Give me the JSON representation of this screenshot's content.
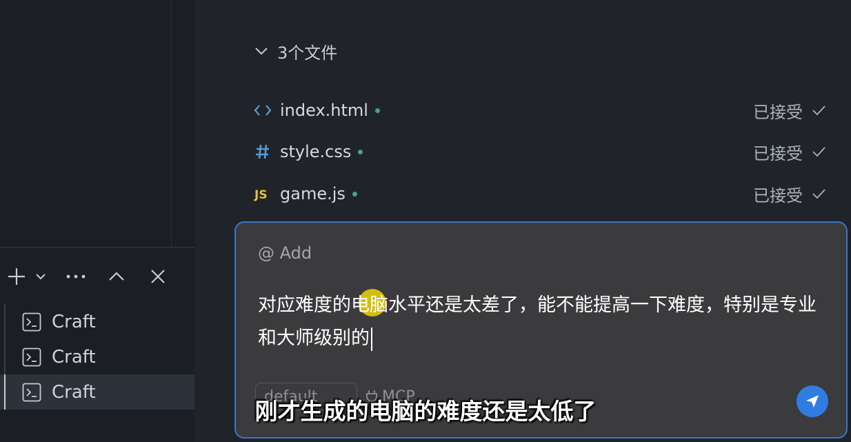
{
  "files": {
    "header": "3个文件",
    "items": [
      {
        "icon": "html-code-icon",
        "name": "index.html",
        "status": "已接受"
      },
      {
        "icon": "hash-icon",
        "name": "style.css",
        "status": "已接受"
      },
      {
        "icon": "js-icon",
        "name": "game.js",
        "status": "已接受"
      }
    ]
  },
  "terminal": {
    "toolbar": [
      "add-icon",
      "chevron-down-icon",
      "more-icon",
      "chevron-up-icon",
      "close-icon"
    ],
    "items": [
      {
        "label": "Craft",
        "active": false
      },
      {
        "label": "Craft",
        "active": false
      },
      {
        "label": "Craft",
        "active": true
      }
    ]
  },
  "chat": {
    "mention_label": "@ Add",
    "input_text": "对应难度的电脑水平还是太差了，能不能提高一下难度，特别是专业和大师级别的",
    "mode_label": "default",
    "mcp_label": "MCP"
  },
  "subtitle": "刚才生成的电脑的难度还是太低了",
  "colors": {
    "accent": "#3b76c9",
    "send": "#2f7de0",
    "status_dot": "#4aa37a",
    "highlight": "#ecd600"
  }
}
